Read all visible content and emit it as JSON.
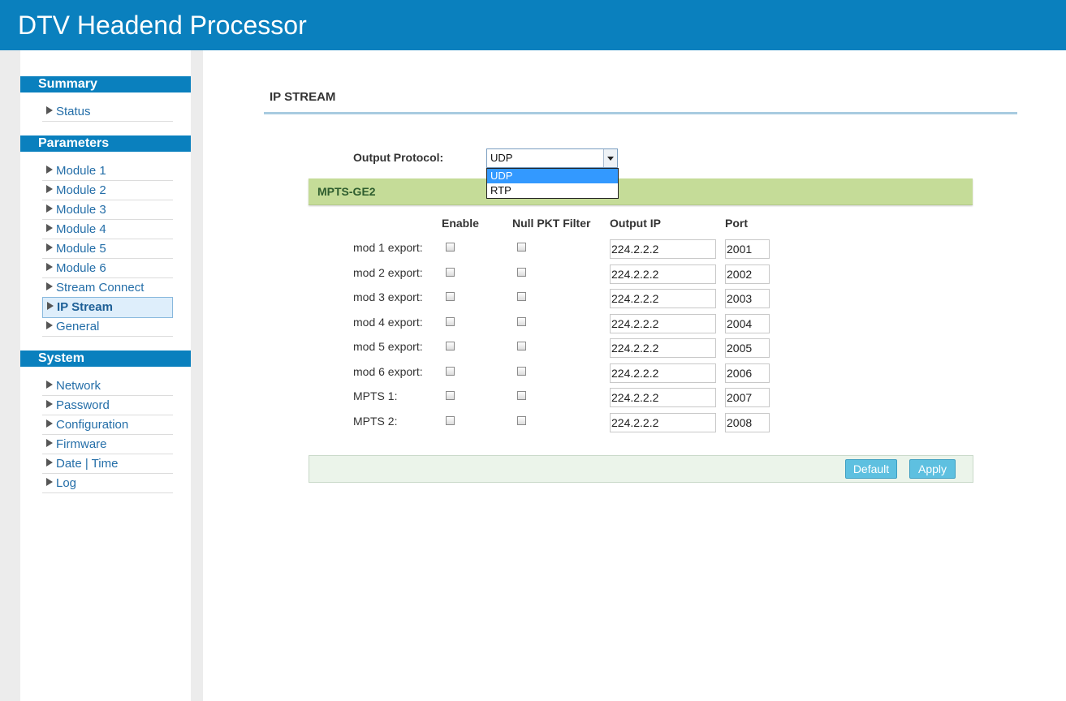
{
  "app": {
    "title": "DTV Headend Processor"
  },
  "sidebar": {
    "summary": {
      "heading": "Summary",
      "items": [
        "Status"
      ]
    },
    "parameters": {
      "heading": "Parameters",
      "items": [
        "Module 1",
        "Module 2",
        "Module 3",
        "Module 4",
        "Module 5",
        "Module 6",
        "Stream Connect",
        "IP Stream",
        "General"
      ],
      "active": "IP Stream"
    },
    "system": {
      "heading": "System",
      "items": [
        "Network",
        "Password",
        "Configuration",
        "Firmware",
        "Date | Time",
        "Log"
      ]
    }
  },
  "main": {
    "page_title": "IP STREAM",
    "output_protocol": {
      "label": "Output Protocol:",
      "value": "UDP",
      "options": [
        "UDP",
        "RTP"
      ],
      "highlighted": "UDP"
    },
    "section_title": "MPTS-GE2",
    "columns": {
      "enable": "Enable",
      "null_pkt": "Null PKT Filter",
      "output_ip": "Output IP",
      "port": "Port"
    },
    "rows": [
      {
        "label": "mod 1 export:",
        "ip": "224.2.2.2",
        "port": "2001"
      },
      {
        "label": "mod 2 export:",
        "ip": "224.2.2.2",
        "port": "2002"
      },
      {
        "label": "mod 3 export:",
        "ip": "224.2.2.2",
        "port": "2003"
      },
      {
        "label": "mod 4 export:",
        "ip": "224.2.2.2",
        "port": "2004"
      },
      {
        "label": "mod 5 export:",
        "ip": "224.2.2.2",
        "port": "2005"
      },
      {
        "label": "mod 6 export:",
        "ip": "224.2.2.2",
        "port": "2006"
      },
      {
        "label": "MPTS 1:",
        "ip": "224.2.2.2",
        "port": "2007"
      },
      {
        "label": "MPTS 2:",
        "ip": "224.2.2.2",
        "port": "2008"
      }
    ],
    "buttons": {
      "default": "Default",
      "apply": "Apply"
    }
  },
  "colors": {
    "header": "#0a80be",
    "section_bar": "#c5dc98",
    "button": "#5ec0e0",
    "dropdown_selected": "#3399ff"
  }
}
